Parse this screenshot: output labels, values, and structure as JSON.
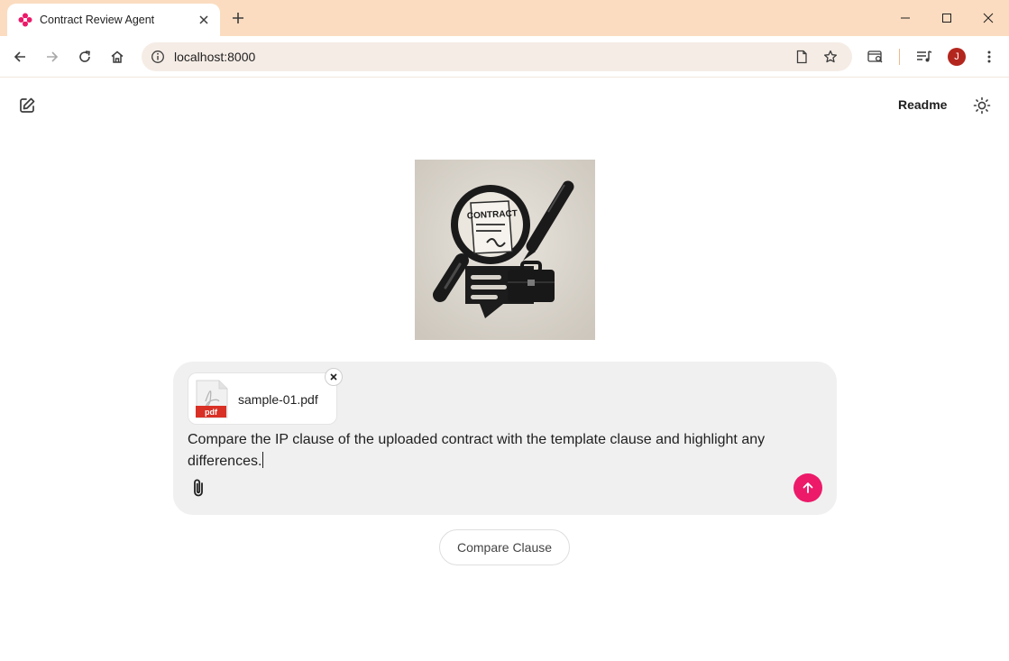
{
  "browser": {
    "tab": {
      "title": "Contract Review Agent"
    },
    "address": {
      "url": "localhost:8000"
    },
    "profile_initial": "J"
  },
  "app": {
    "header": {
      "readme_label": "Readme"
    },
    "hero_image": {
      "alt": "Contract review illustration",
      "label": "CONTRACT"
    },
    "composer": {
      "attachment": {
        "file_name": "sample-01.pdf",
        "file_type": "pdf"
      },
      "prompt_text": "Compare the IP clause of the uploaded contract with the template clause and highlight any differences."
    },
    "suggestions": [
      {
        "label": "Compare Clause"
      }
    ]
  },
  "colors": {
    "titlebar": "#fbdcc0",
    "accent": "#ec1a69",
    "pdf_red": "#d93025",
    "avatar": "#b3261e"
  }
}
